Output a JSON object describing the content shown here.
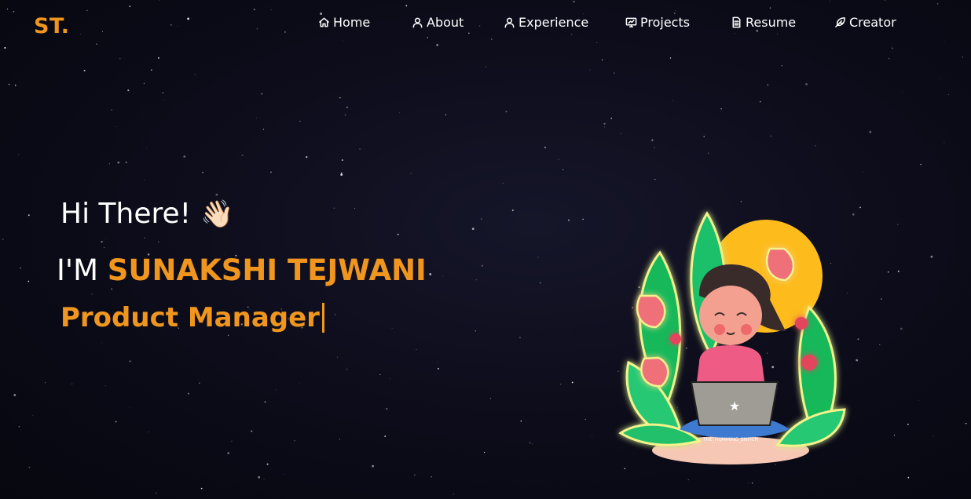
{
  "logo": {
    "text": "ST."
  },
  "nav": {
    "items": [
      {
        "label": "Home",
        "icon": "home-icon"
      },
      {
        "label": "About",
        "icon": "user-icon"
      },
      {
        "label": "Experience",
        "icon": "user-icon"
      },
      {
        "label": "Projects",
        "icon": "presentation-icon"
      },
      {
        "label": "Resume",
        "icon": "document-icon"
      },
      {
        "label": "Creator",
        "icon": "feather-icon"
      }
    ]
  },
  "hero": {
    "greeting": "Hi There!",
    "wave_emoji": "👋🏻",
    "name_prefix": "I'M",
    "name": "SUNAKSHI TEJWANI",
    "role": "Product Manager"
  },
  "illustration": {
    "icon": "girl-with-laptop-illustration",
    "signature": "THE_HUMMING_SNITCH"
  },
  "colors": {
    "accent": "#f0961e",
    "background": "#0d0d1c",
    "text": "#ffffff"
  }
}
